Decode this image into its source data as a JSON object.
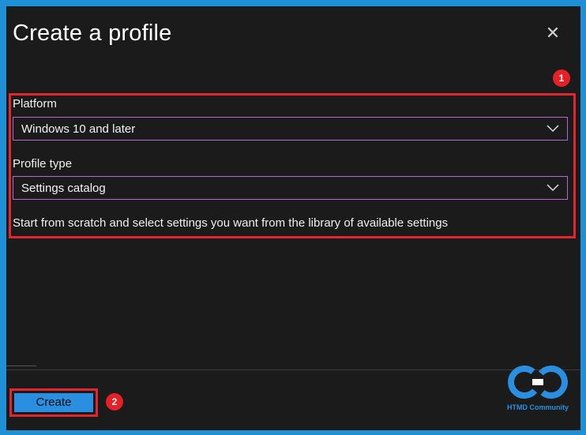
{
  "dialog": {
    "title": "Create a profile",
    "close_icon": "close-icon"
  },
  "form": {
    "platform_label": "Platform",
    "platform_value": "Windows 10 and later",
    "profile_type_label": "Profile type",
    "profile_type_value": "Settings catalog",
    "description": "Start from scratch and select settings you want from the library of available settings"
  },
  "footer": {
    "create_label": "Create"
  },
  "annotations": {
    "badge_1": "1",
    "badge_2": "2"
  },
  "watermark": {
    "text": "HTMD Community",
    "logo_text": "cho"
  },
  "colors": {
    "page_border": "#1f8fd6",
    "panel_bg": "#1b1b1b",
    "highlight": "#e3262e",
    "select_border": "#b865d8",
    "primary_button": "#2a8fe0"
  }
}
